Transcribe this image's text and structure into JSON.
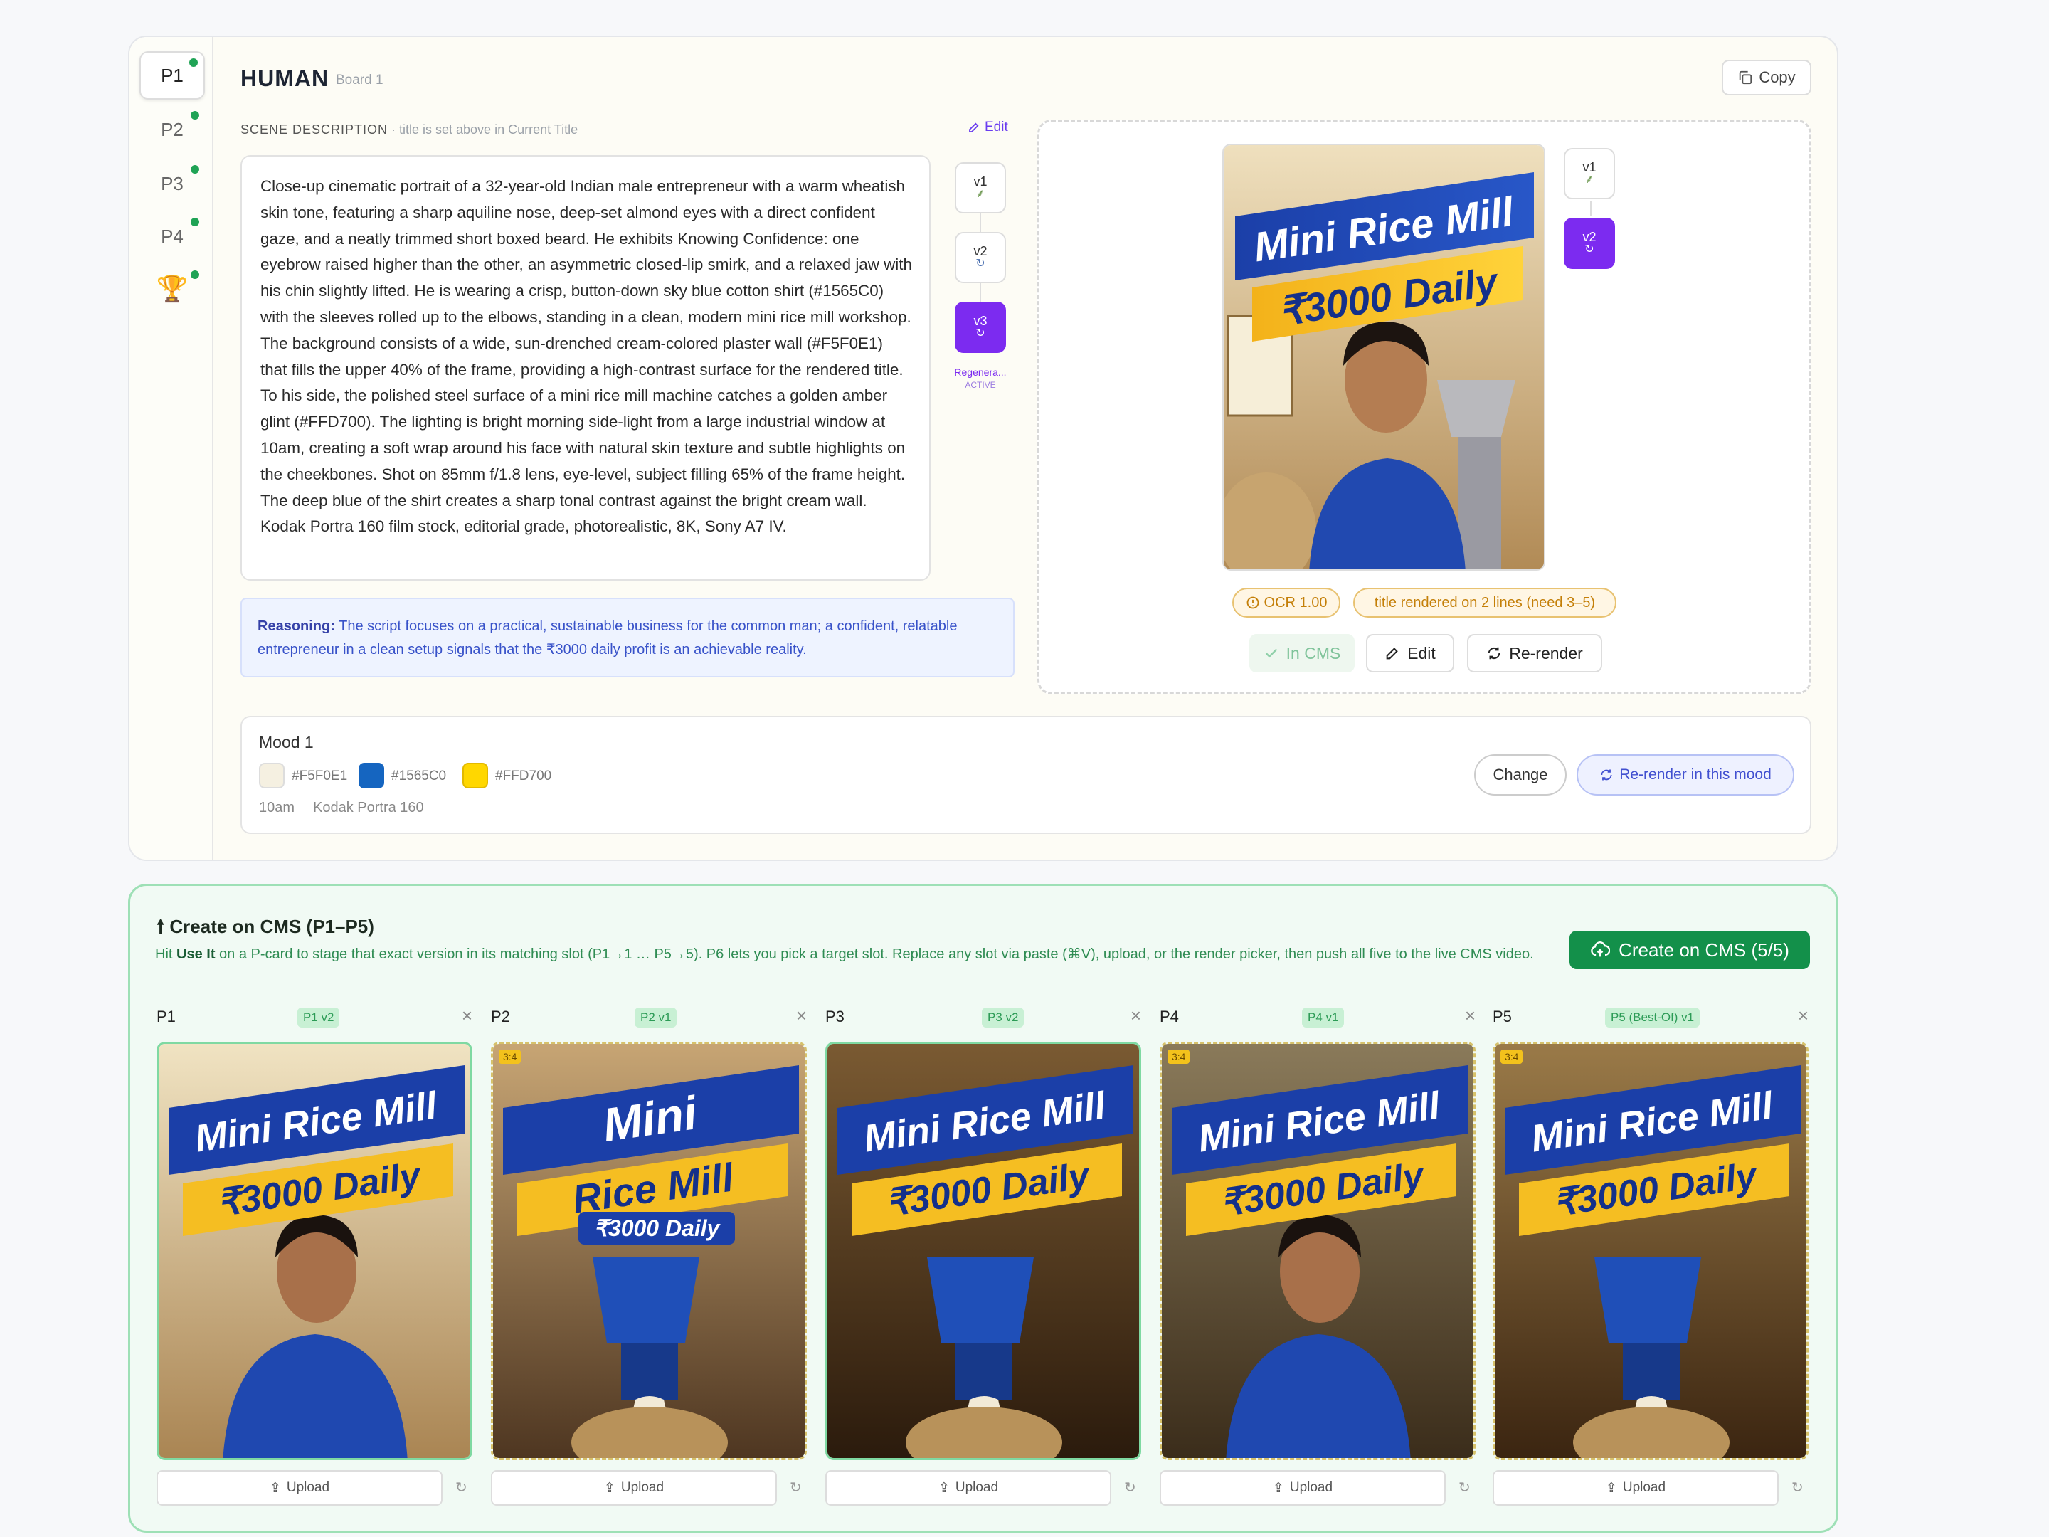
{
  "tabs": [
    {
      "label": "P1",
      "active": true
    },
    {
      "label": "P2",
      "active": false
    },
    {
      "label": "P3",
      "active": false
    },
    {
      "label": "P4",
      "active": false
    },
    {
      "label": "🏆",
      "active": false
    }
  ],
  "header": {
    "title": "HUMAN",
    "subtitle": "Board 1",
    "copy_label": "Copy"
  },
  "scene": {
    "label": "SCENE DESCRIPTION",
    "note": "· title is set above in Current Title",
    "edit_label": "Edit",
    "description": "Close-up cinematic portrait of a 32-year-old Indian male entrepreneur with a warm wheatish skin tone, featuring a sharp aquiline nose, deep-set almond eyes with a direct confident gaze, and a neatly trimmed short boxed beard. He exhibits Knowing Confidence: one eyebrow raised higher than the other, an asymmetric closed-lip smirk, and a relaxed jaw with his chin slightly lifted. He is wearing a crisp, button-down sky blue cotton shirt (#1565C0) with the sleeves rolled up to the elbows, standing in a clean, modern mini rice mill workshop. The background consists of a wide, sun-drenched cream-colored plaster wall (#F5F0E1) that fills the upper 40% of the frame, providing a high-contrast surface for the rendered title. To his side, the polished steel surface of a mini rice mill machine catches a golden amber glint (#FFD700). The lighting is bright morning side-light from a large industrial window at 10am, creating a soft wrap around his face with natural skin texture and subtle highlights on the cheekbones. Shot on 85mm f/1.8 lens, eye-level, subject filling 65% of the frame height. The deep blue of the shirt creates a sharp tonal contrast against the bright cream wall. Kodak Portra 160 film stock, editorial grade, photorealistic, 8K, Sony A7 IV.",
    "versions": [
      {
        "label": "v1",
        "active": false
      },
      {
        "label": "v2",
        "active": false
      },
      {
        "label": "v3",
        "active": true
      }
    ],
    "regen_label": "Regenera...",
    "regen_status": "ACTIVE",
    "reasoning_label": "Reasoning:",
    "reasoning_text": "The script focuses on a practical, sustainable business for the common man; a confident, relatable entrepreneur in a clean setup signals that the ₹3000 daily profit is an achievable reality."
  },
  "preview": {
    "poster_title": "Mini Rice Mill",
    "poster_subtitle": "₹3000 Daily",
    "versions": [
      {
        "label": "v1",
        "active": false
      },
      {
        "label": "v2",
        "active": true
      }
    ],
    "ocr_badge": "OCR 1.00",
    "warning_badge": "title rendered on 2 lines (need 3–5)",
    "in_cms_label": "In CMS",
    "edit_label": "Edit",
    "rerender_label": "Re-render"
  },
  "mood": {
    "title": "Mood 1",
    "swatches": [
      {
        "color": "#F5F0E1",
        "label": "#F5F0E1"
      },
      {
        "color": "#1565C0",
        "label": "#1565C0"
      },
      {
        "color": "#FFD700",
        "label": "#FFD700"
      }
    ],
    "time": "10am",
    "film": "Kodak Portra 160",
    "change_label": "Change",
    "rerender_label": "Re-render in this mood"
  },
  "cms": {
    "title": "Create on CMS (P1–P5)",
    "desc_prefix": "Hit",
    "desc_bold": "Use It",
    "desc_rest": "on a P-card to stage that exact version in its matching slot (P1→1 … P5→5). P6 lets you pick a target slot. Replace any slot via paste (⌘V), upload, or the render picker, then push all five to the live CMS video.",
    "button_label": "Create on CMS (5/5)",
    "upload_label": "Upload",
    "slots": [
      {
        "label": "P1",
        "tag": "P1 v2",
        "ratio": "",
        "title_a": "Mini Rice Mill",
        "title_b": "₹3000 Daily"
      },
      {
        "label": "P2",
        "tag": "P2 v1",
        "ratio": "3:4",
        "title_a": "Mini",
        "title_b": "Rice Mill",
        "title_c": "₹3000 Daily"
      },
      {
        "label": "P3",
        "tag": "P3 v2",
        "ratio": "",
        "title_a": "Mini Rice Mill",
        "title_b": "₹3000 Daily"
      },
      {
        "label": "P4",
        "tag": "P4 v1",
        "ratio": "3:4",
        "title_a": "Mini Rice Mill",
        "title_b": "₹3000 Daily"
      },
      {
        "label": "P5",
        "tag": "P5 (Best-Of) v1",
        "ratio": "3:4",
        "title_a": "Mini Rice Mill",
        "title_b": "₹3000 Daily"
      }
    ]
  }
}
